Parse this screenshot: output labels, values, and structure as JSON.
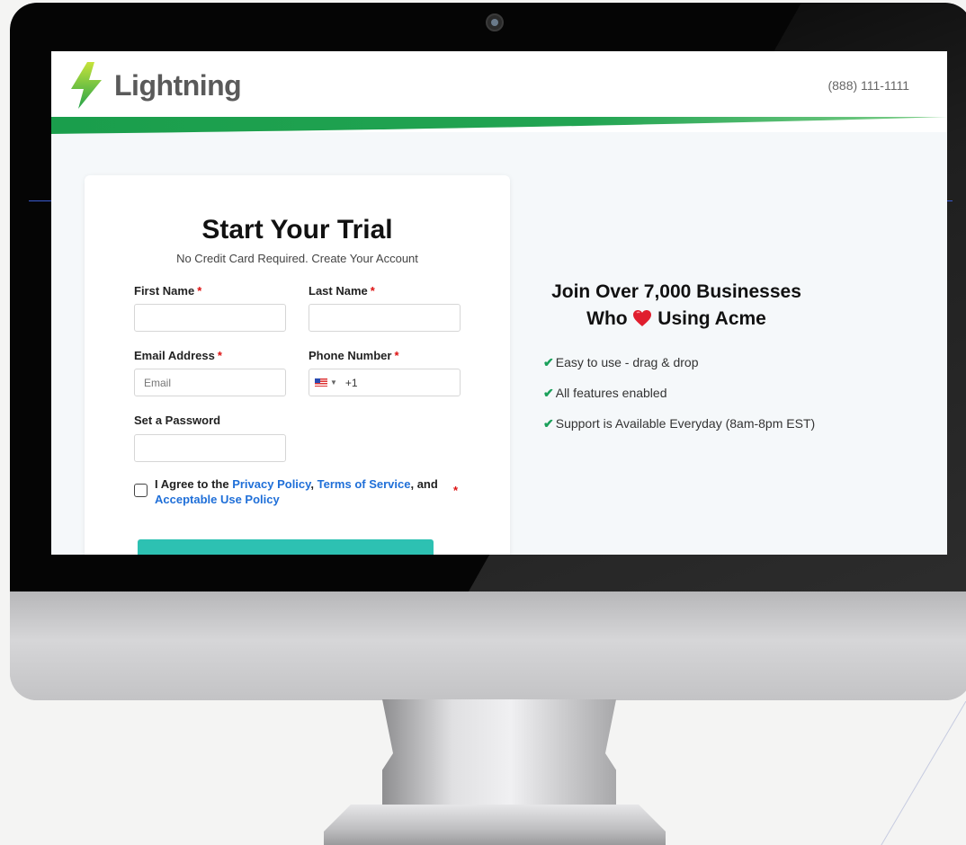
{
  "brand": {
    "name": "Lightning",
    "phone": "(888) 111-1111"
  },
  "form": {
    "title": "Start Your Trial",
    "subtitle": "No Credit Card Required. Create Your Account",
    "first_name_label": "First Name",
    "last_name_label": "Last Name",
    "email_label": "Email Address",
    "email_placeholder": "Email",
    "phone_label": "Phone Number",
    "phone_dial_code": "+1",
    "phone_country": "us-flag-icon",
    "password_label": "Set a Password",
    "required_mark": "*",
    "agree_prefix": "I Agree to the ",
    "privacy_link": "Privacy Policy",
    "comma": ", ",
    "terms_link": "Terms of Service",
    "agree_mid": ", and ",
    "aup_link": "Acceptable Use Policy",
    "submit_color": "#2dc1b2"
  },
  "promo": {
    "line1": "Join Over 7,000 Businesses",
    "line2_prefix": "Who ",
    "line2_suffix": " Using Acme",
    "heart_icon": "heart-icon",
    "features": [
      "Easy to use - drag & drop",
      "All features enabled",
      "Support is Available Everyday (8am-8pm EST)"
    ]
  },
  "colors": {
    "brand_green": "#1e9a46",
    "link_blue": "#1f6fd8",
    "required_red": "#dd1111",
    "check_green": "#1aa05a"
  }
}
